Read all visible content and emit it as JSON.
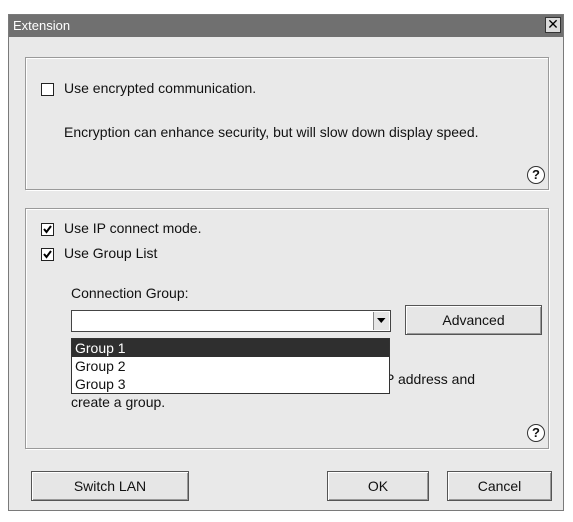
{
  "dialog": {
    "title": "Extension",
    "close_glyph": "✕",
    "encryption": {
      "checkbox_label": "Use encrypted communication.",
      "checked": false,
      "description": "Encryption can enhance security, but will slow down display speed.",
      "help_glyph": "?"
    },
    "connection": {
      "ip_mode_label": "Use IP connect mode.",
      "ip_mode_checked": true,
      "group_list_label": "Use Group List",
      "group_list_checked": true,
      "group_label": "Connection Group:",
      "group_value": "",
      "options": [
        "Group 1",
        "Group 2",
        "Group 3"
      ],
      "highlighted_option": "Group 1",
      "advanced_label": "Advanced",
      "hint_visible_right": "P address and",
      "hint_visible_line2": "create a group.",
      "help_glyph": "?"
    },
    "buttons": {
      "switch_lan": "Switch LAN",
      "ok": "OK",
      "cancel": "Cancel"
    }
  }
}
